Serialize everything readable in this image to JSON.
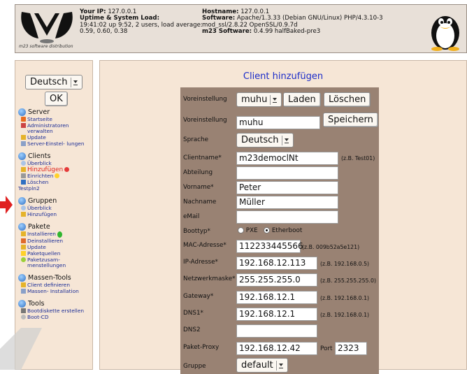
{
  "header": {
    "logo_caption": "m23 software distribution",
    "col1": {
      "l1_label": "Your IP:",
      "l1_value": "127.0.0.1",
      "l2_label": "Uptime & System Load:",
      "l3": "19:41:02 up 9:52, 2 users, load average:",
      "l4": "0.59, 0.60, 0.38"
    },
    "col2": {
      "l1_label": "Hostname:",
      "l1_value": "127.0.0.1",
      "l2_label": "Software:",
      "l2_value": "Apache/1.3.33 (Debian GNU/Linux) PHP/4.3.10-3",
      "l3": "mod_ssl/2.8.22 OpenSSL/0.9.7d",
      "l4_label": "m23 Software:",
      "l4_value": "0.4.99 halfBaked-pre3"
    }
  },
  "sidebar": {
    "language_select": "Deutsch",
    "ok_button": "OK",
    "sections": [
      {
        "title": "Server",
        "items": [
          "Startseite",
          "Administratoren verwalten",
          "Update",
          "Server-Einstel- lungen"
        ]
      },
      {
        "title": "Clients",
        "items": [
          "Überblick",
          "Hinzufügen",
          "Einrichten",
          "Löschen"
        ],
        "extra": "Testpln2"
      },
      {
        "title": "Gruppen",
        "items": [
          "Überblick",
          "Hinzufügen"
        ]
      },
      {
        "title": "Pakete",
        "items": [
          "Installieren",
          "Deinstallieren",
          "Update",
          "Paketquellen",
          "Paketzusam- menstellungen"
        ]
      },
      {
        "title": "Massen-Tools",
        "items": [
          "Client definieren",
          "Massen- Installation"
        ]
      },
      {
        "title": "Tools",
        "items": [
          "Bootdiskette erstellen",
          "Boot-CD"
        ]
      }
    ]
  },
  "form": {
    "title": "Client hinzufügen",
    "preset1_label": "Voreinstellung",
    "preset1_select": "muhu",
    "load_button": "Laden",
    "delete_button": "Löschen",
    "preset2_label": "Voreinstellung",
    "preset2_value": "muhu",
    "save_button": "Speichern",
    "language_label": "Sprache",
    "language_select": "Deutsch",
    "clientname_label": "Clientname*",
    "clientname_value": "m23democlNt",
    "clientname_hint": "(z.B. Test01)",
    "department_label": "Abteilung",
    "department_value": "",
    "firstname_label": "Vorname*",
    "firstname_value": "Peter",
    "lastname_label": "Nachname",
    "lastname_value": "Müller",
    "email_label": "eMail",
    "email_value": "",
    "boottype_label": "Boottyp*",
    "boot_pxe": "PXE",
    "boot_etherboot": "Etherboot",
    "mac_label": "MAC-Adresse*",
    "mac_value": "112233445566",
    "mac_hint": "(z.B. 009b52a5e121)",
    "ip_label": "IP-Adresse*",
    "ip_value": "192.168.12.113",
    "ip_hint": "(z.B. 192.168.0.5)",
    "netmask_label": "Netzwerkmaske*",
    "netmask_value": "255.255.255.0",
    "netmask_hint": "(z.B. 255.255.255.0)",
    "gateway_label": "Gateway*",
    "gateway_value": "192.168.12.1",
    "gateway_hint": "(z.B. 192.168.0.1)",
    "dns1_label": "DNS1*",
    "dns1_value": "192.168.12.1",
    "dns1_hint": "(z.B. 192.168.0.1)",
    "dns2_label": "DNS2",
    "dns2_value": "",
    "proxy_label": "Paket-Proxy",
    "proxy_value": "192.168.12.42",
    "port_label": "Port",
    "port_value": "2323",
    "group_label": "Gruppe",
    "group_select": "default"
  }
}
